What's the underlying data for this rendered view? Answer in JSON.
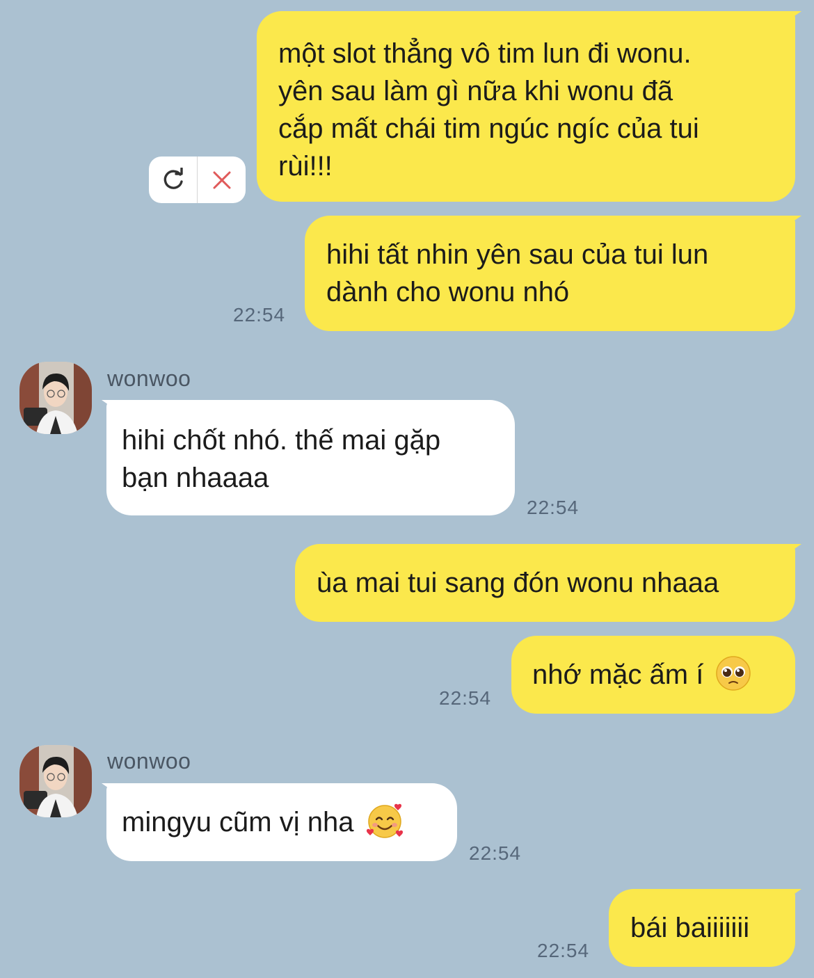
{
  "messages": [
    {
      "id": "m1",
      "from": "me",
      "lines": [
        "một slot thẳng vô tim lun đi wonu.",
        "yên sau làm gì nữa khi wonu đã",
        "cắp mất chái tim ngúc ngíc của tui",
        "rùi!!!"
      ],
      "status": "failed"
    },
    {
      "id": "m2",
      "from": "me",
      "lines": [
        "hihi tất nhin yên sau của tui lun",
        "dành cho wonu nhó"
      ],
      "time": "22:54"
    },
    {
      "id": "m3",
      "from": "them",
      "sender": "wonwoo",
      "lines": [
        "hihi chốt nhó. thế mai gặp",
        "bạn nhaaaa"
      ],
      "time": "22:54"
    },
    {
      "id": "m4",
      "from": "me",
      "lines": [
        "ùa mai tui sang đón wonu nhaaa"
      ]
    },
    {
      "id": "m5",
      "from": "me",
      "lines": [
        "nhớ mặc ấm í"
      ],
      "emoji": "pleading-face-emoji",
      "time": "22:54"
    },
    {
      "id": "m6",
      "from": "them",
      "sender": "wonwoo",
      "lines": [
        "mingyu cũm vị nha"
      ],
      "emoji": "smiling-face-with-hearts-emoji",
      "time": "22:54"
    },
    {
      "id": "m7",
      "from": "me",
      "lines": [
        "bái baiiiiiii"
      ],
      "time": "22:54"
    }
  ],
  "failed_actions": {
    "retry_icon": "retry-icon",
    "delete_icon": "delete-icon"
  },
  "colors": {
    "background": "#abc1d1",
    "my_bubble": "#fbe84c",
    "their_bubble": "#ffffff",
    "delete_x": "#e05a5a"
  }
}
